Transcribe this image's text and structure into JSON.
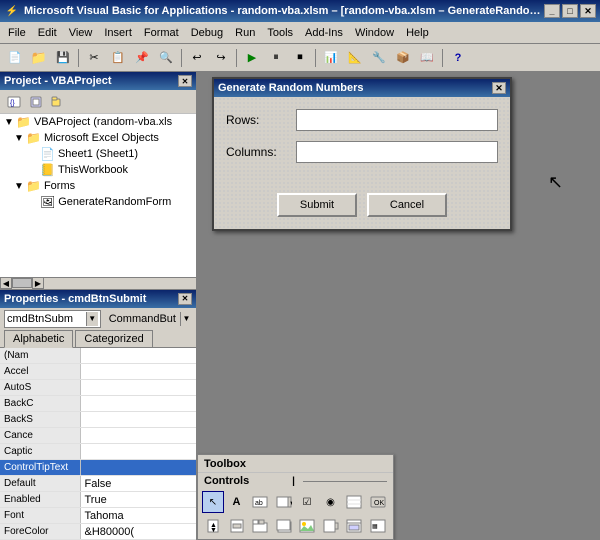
{
  "titlebar": {
    "title": "Microsoft Visual Basic for Applications - random-vba.xlsm – [random-vba.xlsm – GenerateRandom...",
    "icon": "⚡"
  },
  "menubar": {
    "items": [
      "File",
      "Edit",
      "View",
      "Insert",
      "Format",
      "Debug",
      "Run",
      "Tools",
      "Add-Ins",
      "Window",
      "Help"
    ]
  },
  "project_panel": {
    "title": "Project - VBAProject",
    "tree": [
      {
        "label": "VBAProject (random-vba.xls",
        "level": 0,
        "icon": "📁",
        "expand": "▼"
      },
      {
        "label": "Microsoft Excel Objects",
        "level": 1,
        "icon": "📁",
        "expand": "▼"
      },
      {
        "label": "Sheet1 (Sheet1)",
        "level": 2,
        "icon": "📄",
        "expand": ""
      },
      {
        "label": "ThisWorkbook",
        "level": 2,
        "icon": "📒",
        "expand": ""
      },
      {
        "label": "Forms",
        "level": 1,
        "icon": "📁",
        "expand": "▼"
      },
      {
        "label": "GenerateRandomForm",
        "level": 2,
        "icon": "🖼",
        "expand": ""
      }
    ]
  },
  "properties_panel": {
    "title": "Properties - cmdBtnSubmit",
    "selector_text": "cmdBtnSubm",
    "selector_type": "CommandBut",
    "tabs": [
      "Alphabetic",
      "Categorized"
    ],
    "active_tab": "Alphabetic",
    "rows": [
      {
        "name": "(Nam",
        "value": ""
      },
      {
        "name": "Accel",
        "value": ""
      },
      {
        "name": "AutoS",
        "value": ""
      },
      {
        "name": "BackC",
        "value": ""
      },
      {
        "name": "BackS",
        "value": ""
      },
      {
        "name": "Cance",
        "value": ""
      },
      {
        "name": "Captic",
        "value": ""
      },
      {
        "name": "ControlTipText",
        "value": "",
        "selected": true
      },
      {
        "name": "Default",
        "value": "False"
      },
      {
        "name": "Enabled",
        "value": "True"
      },
      {
        "name": "Font",
        "value": "Tahoma"
      },
      {
        "name": "ForeColor",
        "value": "&H80000("
      }
    ]
  },
  "dialog": {
    "title": "Generate Random Numbers",
    "rows_label": "Rows:",
    "columns_label": "Columns:",
    "submit_btn": "Submit",
    "cancel_btn": "Cancel"
  },
  "toolbox": {
    "title": "Toolbox",
    "section": "Controls",
    "row1_icons": [
      "↖",
      "A",
      "▭",
      "▭",
      "☑",
      "◉",
      "▣",
      ""
    ],
    "row2_icons": [
      "⬜",
      "▭",
      "↔",
      "▣",
      "▣",
      "🖼",
      "▦",
      ""
    ],
    "selected_index": 0
  }
}
